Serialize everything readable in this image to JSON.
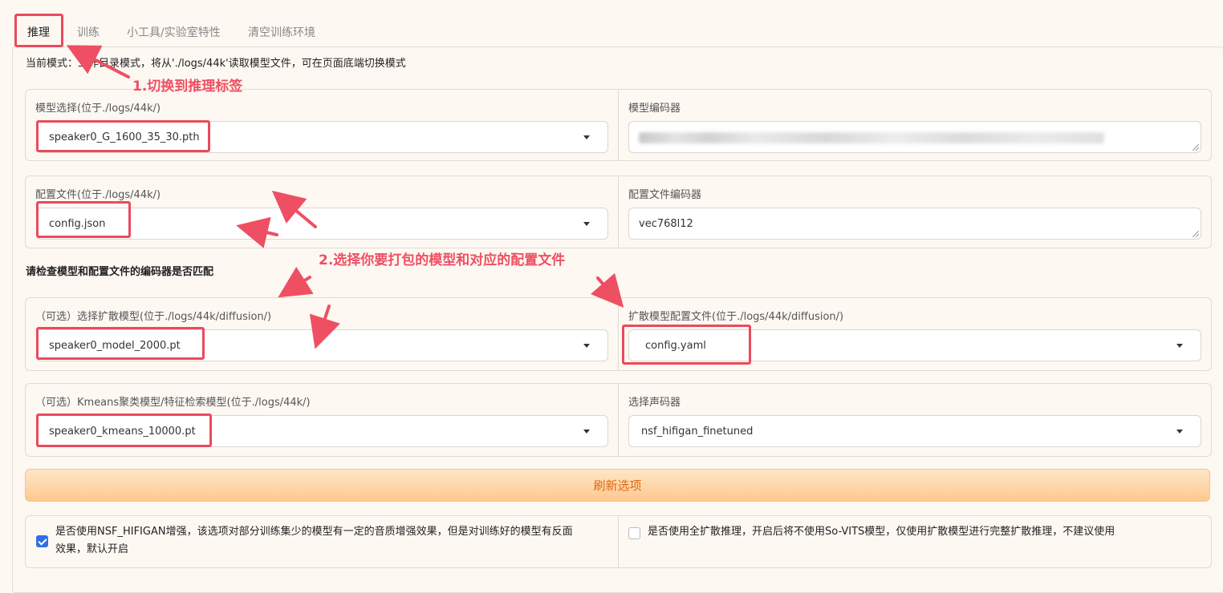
{
  "tabs": [
    "推理",
    "训练",
    "小工具/实验室特性",
    "清空训练环境"
  ],
  "mode_text": "当前模式：工作目录模式，将从'./logs/44k'读取模型文件，可在页面底端切换模式",
  "model": {
    "label": "模型选择(位于./logs/44k/)",
    "value": "speaker0_G_1600_35_30.pth",
    "encoder_label": "模型编码器",
    "encoder_value": ""
  },
  "config": {
    "label": "配置文件(位于./logs/44k/)",
    "value": "config.json",
    "encoder_label": "配置文件编码器",
    "encoder_value": "vec768l12"
  },
  "check_text": "请检查模型和配置文件的编码器是否匹配",
  "diffusion": {
    "label": "（可选）选择扩散模型(位于./logs/44k/diffusion/)",
    "value": "speaker0_model_2000.pt",
    "config_label": "扩散模型配置文件(位于./logs/44k/diffusion/)",
    "config_value": "config.yaml"
  },
  "kmeans": {
    "label": "（可选）Kmeans聚类模型/特征检索模型(位于./logs/44k/)",
    "value": "speaker0_kmeans_10000.pt",
    "vocoder_label": "选择声码器",
    "vocoder_value": "nsf_hifigan_finetuned"
  },
  "refresh_label": "刷新选项",
  "nsf_enhance": {
    "checked": true,
    "line1": "是否使用NSF_HIFIGAN增强，该选项对部分训练集少的模型有一定的音质增强效果，但是对训练好的模型有反面",
    "line2": "效果，默认开启"
  },
  "full_diffusion": {
    "checked": false,
    "text": "是否使用全扩散推理，开启后将不使用So-VITS模型，仅使用扩散模型进行完整扩散推理，不建议使用"
  },
  "annotations": {
    "step1": "1.切换到推理标签",
    "step2": "2.选择你要打包的模型和对应的配置文件",
    "color": "#ef4f63"
  }
}
